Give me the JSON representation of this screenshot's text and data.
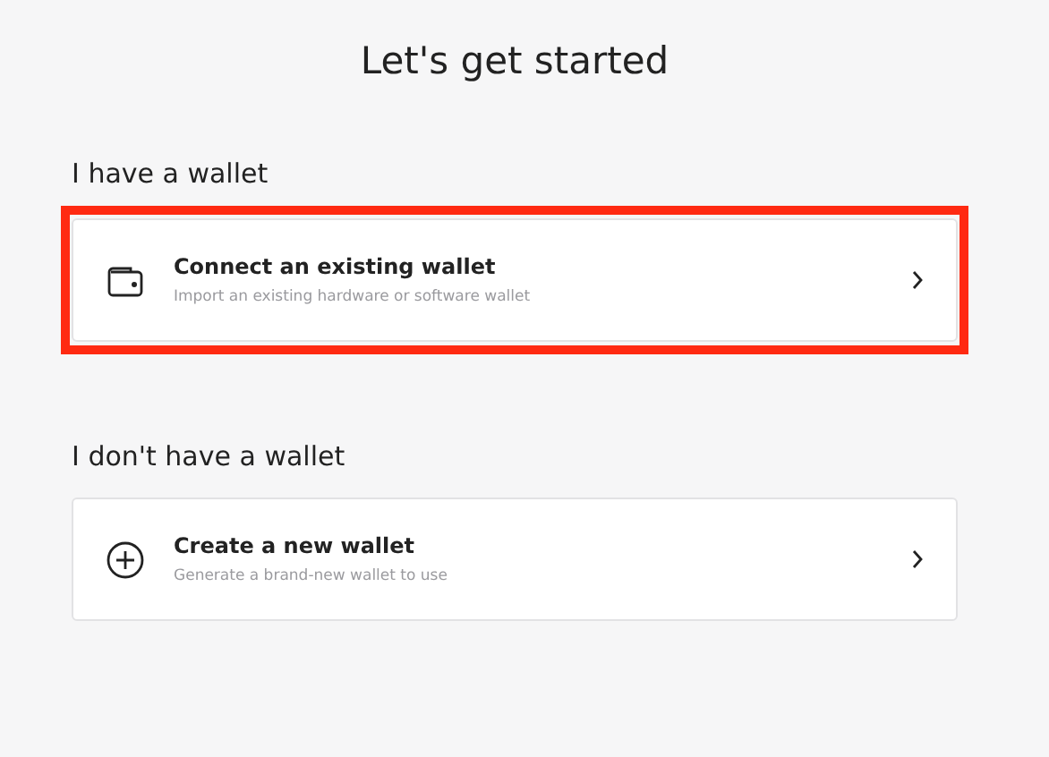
{
  "title": "Let's get started",
  "sections": [
    {
      "heading": "I have a wallet",
      "options": [
        {
          "kind": "connect",
          "title": "Connect an existing wallet",
          "subtitle": "Import an existing hardware or software wallet",
          "highlighted": true
        }
      ]
    },
    {
      "heading": "I don't have a wallet",
      "options": [
        {
          "kind": "create",
          "title": "Create a new wallet",
          "subtitle": "Generate a brand-new wallet to use",
          "highlighted": false
        }
      ]
    }
  ]
}
